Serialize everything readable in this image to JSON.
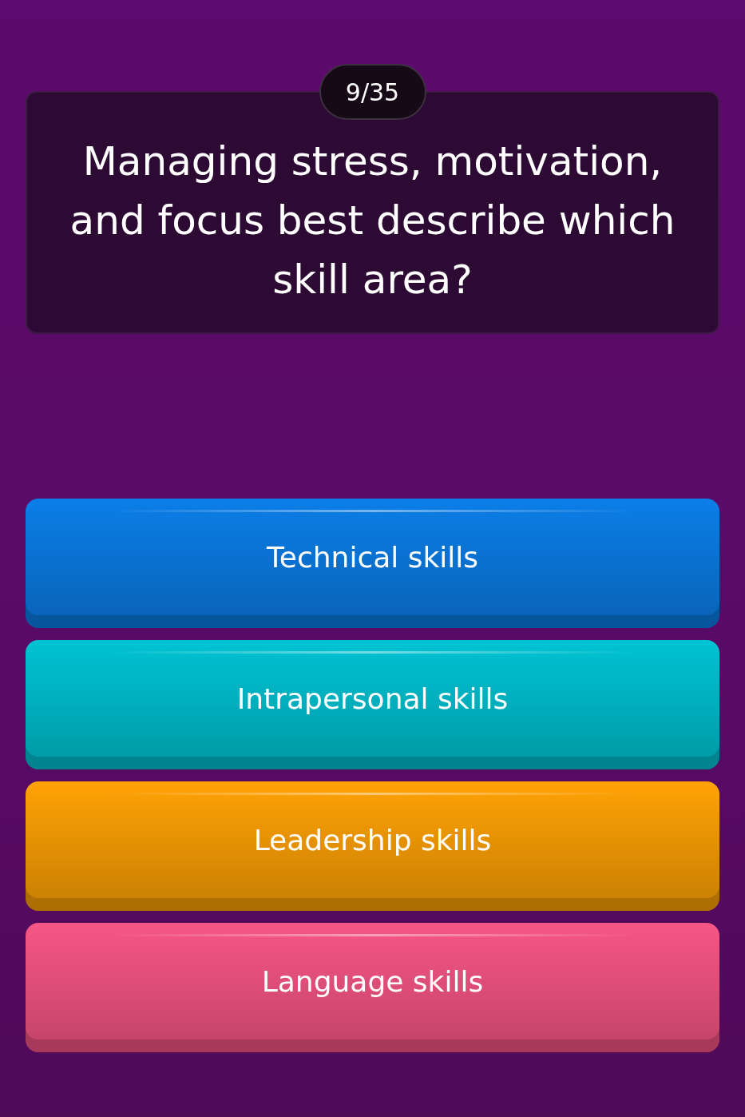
{
  "counter": "9/35",
  "question": "Managing stress, motivation, and focus best describe which skill area?",
  "options": [
    {
      "label": "Technical skills",
      "color": "#0b7ee8"
    },
    {
      "label": "Intrapersonal skills",
      "color": "#00c3d3"
    },
    {
      "label": "Leadership skills",
      "color": "#ffa205"
    },
    {
      "label": "Language skills",
      "color": "#f75685"
    }
  ]
}
